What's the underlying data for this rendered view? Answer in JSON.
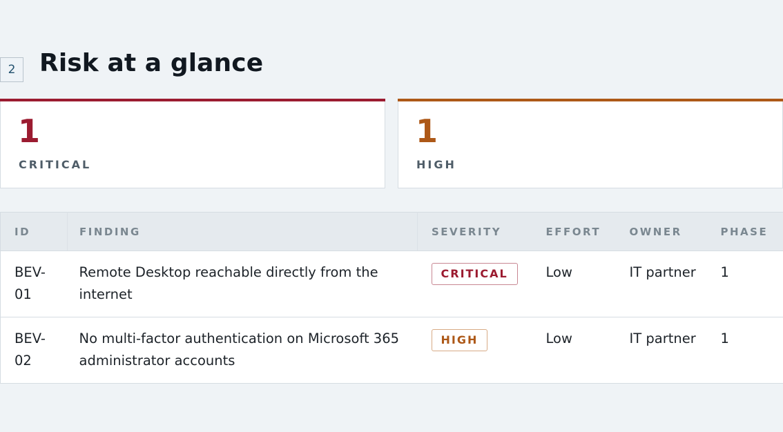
{
  "section": {
    "number": "2",
    "title": "Risk at a glance"
  },
  "summary": {
    "critical": {
      "count": "1",
      "label": "CRITICAL"
    },
    "high": {
      "count": "1",
      "label": "HIGH"
    }
  },
  "table": {
    "headers": {
      "id": "ID",
      "finding": "FINDING",
      "severity": "SEVERITY",
      "effort": "EFFORT",
      "owner": "OWNER",
      "phase": "PHASE"
    },
    "rows": [
      {
        "id": "BEV-01",
        "finding": "Remote Desktop reachable directly from the internet",
        "severity": "CRITICAL",
        "effort": "Low",
        "owner": "IT partner",
        "phase": "1"
      },
      {
        "id": "BEV-02",
        "finding": "No multi-factor authentication on Microsoft 365 administrator accounts",
        "severity": "HIGH",
        "effort": "Low",
        "owner": "IT partner",
        "phase": "1"
      }
    ]
  },
  "colors": {
    "critical": "#9b1b30",
    "high": "#ad5817",
    "background": "#eff3f6"
  }
}
